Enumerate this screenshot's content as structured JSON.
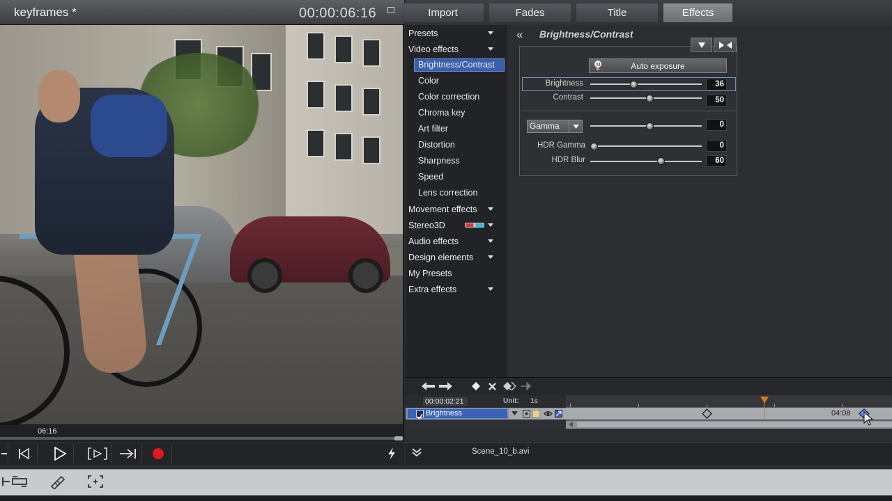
{
  "preview": {
    "title": "keyframes *",
    "timecode": "00:00:06:16",
    "scrub_time": "06:16"
  },
  "transport": {
    "buttons": [
      "step-back-icon",
      "play-icon",
      "mark-in-out-icon",
      "jump-end-icon",
      "record-icon",
      "lightning-icon"
    ]
  },
  "tabs": [
    {
      "label": "Import"
    },
    {
      "label": "Fades"
    },
    {
      "label": "Title"
    },
    {
      "label": "Effects",
      "active": true
    }
  ],
  "categories": {
    "presets": "Presets",
    "video_effects": "Video effects",
    "video_sub": [
      "Brightness/Contrast",
      "Color",
      "Color correction",
      "Chroma key",
      "Art filter",
      "Distortion",
      "Sharpness",
      "Speed",
      "Lens correction"
    ],
    "movement_effects": "Movement effects",
    "stereo3d": "Stereo3D",
    "audio_effects": "Audio effects",
    "design_elements": "Design elements",
    "my_presets": "My Presets",
    "extra_effects": "Extra effects"
  },
  "effect": {
    "back_glyph": "«",
    "title": "Brightness/Contrast",
    "auto_exposure": "Auto exposure",
    "params": {
      "brightness": {
        "label": "Brightness",
        "value": "36",
        "fraction": 0.36
      },
      "contrast": {
        "label": "Contrast",
        "value": "50",
        "fraction": 0.5
      },
      "gamma": {
        "label": "Gamma",
        "value": "0",
        "fraction": 0.5
      },
      "hdr_gamma": {
        "label": "HDR Gamma",
        "value": "0",
        "fraction": 0.0
      },
      "hdr_blur": {
        "label": "HDR Blur",
        "value": "60",
        "fraction": 0.6
      }
    }
  },
  "keyframes": {
    "current_time": "00:00:02:21",
    "unit_label": "Unit:",
    "unit_value": "1s",
    "parameter": "Brightness",
    "lane_time": "04:08"
  },
  "status": {
    "file": "Scene_10_b.avi"
  },
  "colors": {
    "selection": "#3b5fae",
    "playhead": "#e07a20",
    "record": "#e01b1b"
  }
}
